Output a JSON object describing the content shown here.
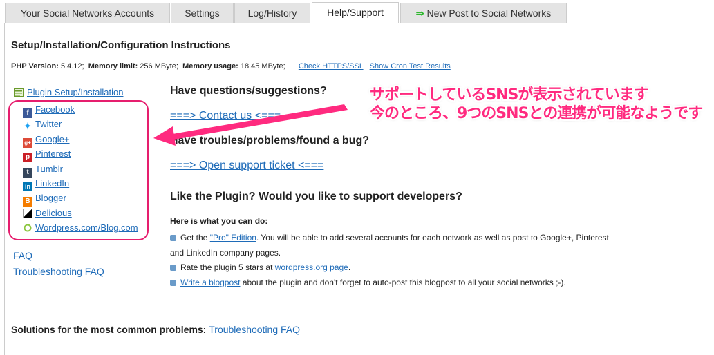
{
  "tabs": [
    {
      "label": "Your Social Networks Accounts",
      "active": false
    },
    {
      "label": "Settings",
      "active": false
    },
    {
      "label": "Log/History",
      "active": false
    },
    {
      "label": "Help/Support",
      "active": true
    },
    {
      "label": "New Post to Social Networks",
      "active": false,
      "icon": "green-arrow-icon"
    }
  ],
  "setup_title": "Setup/Installation/Configuration Instructions",
  "info": {
    "php_label": "PHP Version:",
    "php_value": "5.4.12;",
    "mem_limit_label": "Memory limit:",
    "mem_limit_value": "256 MByte;",
    "mem_usage_label": "Memory usage:",
    "mem_usage_value": "18.45 MByte;",
    "check_https": "Check HTTPS/SSL",
    "cron": "Show Cron Test Results"
  },
  "sidebar": {
    "plugin_setup": "Plugin Setup/Installation",
    "networks": [
      {
        "label": "Facebook",
        "icon": "facebook-icon",
        "color": "#3b5998"
      },
      {
        "label": "Twitter",
        "icon": "twitter-icon",
        "color": "#1da1f2"
      },
      {
        "label": "Google+",
        "icon": "google-plus-icon",
        "color": "#dd4b39"
      },
      {
        "label": "Pinterest",
        "icon": "pinterest-icon",
        "color": "#cb2027"
      },
      {
        "label": "Tumblr",
        "icon": "tumblr-icon",
        "color": "#35465c"
      },
      {
        "label": "LinkedIn",
        "icon": "linkedin-icon",
        "color": "#0077b5"
      },
      {
        "label": "Blogger",
        "icon": "blogger-icon",
        "color": "#f57d00"
      },
      {
        "label": "Delicious",
        "icon": "delicious-icon",
        "color": "#222222"
      },
      {
        "label": "Wordpress.com/Blog.com",
        "icon": "wordpress-icon",
        "color": "#8cc63f"
      }
    ],
    "faq": "FAQ",
    "troubleshooting": "Troubleshooting FAQ"
  },
  "main": {
    "questions_heading": "Have questions/suggestions?",
    "contact_link": "===> Contact us <===",
    "troubles_heading": "Have troubles/problems/found a bug?",
    "ticket_link": "===> Open support ticket <===",
    "like_heading": "Like the Plugin? Would you like to support developers?",
    "here_label": "Here is what you can do:",
    "bullet1_pre": "Get the ",
    "bullet1_link": "\"Pro\" Edition",
    "bullet1_post": ". You will be able to add several accounts for each network as well as post to Google+, Pinterest and LinkedIn company pages.",
    "bullet2_pre": "Rate the plugin 5 stars at ",
    "bullet2_link": "wordpress.org page",
    "bullet2_post": ".",
    "bullet3_link": "Write a blogpost",
    "bullet3_post": " about the plugin and don't forget to auto-post this blogpost to all your social networks ;-)."
  },
  "solutions": {
    "label": "Solutions for the most common problems:",
    "link": "Troubleshooting FAQ"
  },
  "annotation": {
    "line1": "サポートしているSNSが表示されています",
    "line2": "今のところ、9つのSNSとの連携が可能なようです",
    "color": "#ff2a7f"
  }
}
